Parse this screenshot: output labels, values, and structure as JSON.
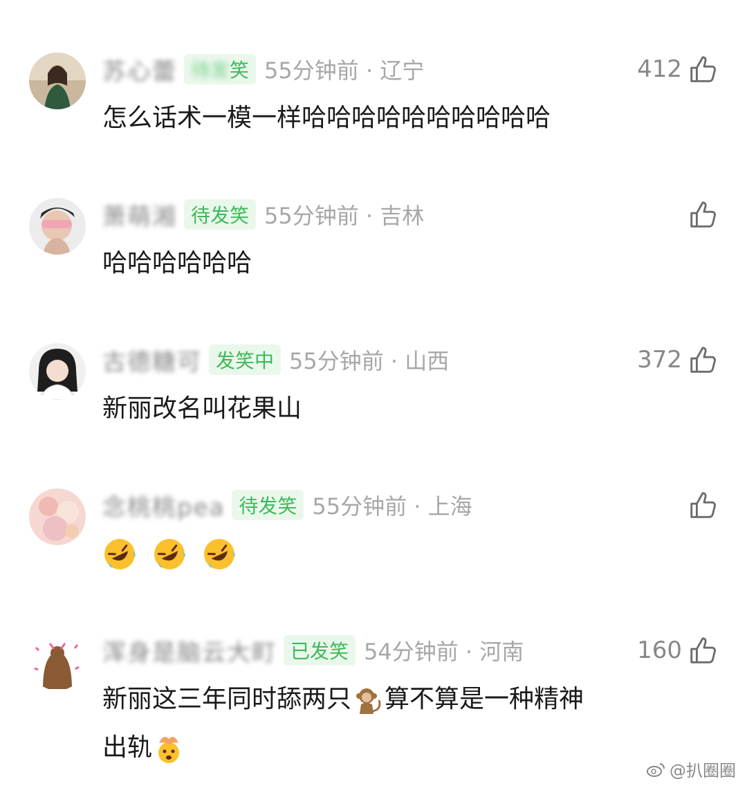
{
  "comments": [
    {
      "name": "苏心蕾",
      "badge": "笑",
      "badge_prefix": "待发",
      "time": "55分钟前",
      "location": "辽宁",
      "likes": "412",
      "text": "怎么话术一模一样哈哈哈哈哈哈哈哈哈哈"
    },
    {
      "name": "萧萌湘",
      "badge": "待发笑",
      "time": "55分钟前",
      "location": "吉林",
      "likes": "",
      "text": "哈哈哈哈哈哈"
    },
    {
      "name": "古德糖可",
      "badge": "发笑中",
      "time": "55分钟前",
      "location": "山西",
      "likes": "372",
      "text": "新丽改名叫花果山"
    },
    {
      "name": "念桃桃pea",
      "badge": "待发笑",
      "time": "55分钟前",
      "location": "上海",
      "likes": "",
      "emoji_count": 3,
      "emoji": "rolling-laughing-face"
    },
    {
      "name": "浑身是脑云大町",
      "badge": "已发笑",
      "time": "54分钟前",
      "location": "河南",
      "likes": "160",
      "text_line1_before": "新丽这三年同时舔两只",
      "text_line1_after": "算不算是一种精神",
      "text_line2": "出轨",
      "inline_emojis": [
        "monkey-icon",
        "mind-blown-icon"
      ]
    }
  ],
  "watermark": "@扒圈圈",
  "meta_separator": "·",
  "colors": {
    "badge_bg": "#eaf8ec",
    "badge_text": "#3fb95a",
    "meta_text": "#a7a7a7"
  }
}
